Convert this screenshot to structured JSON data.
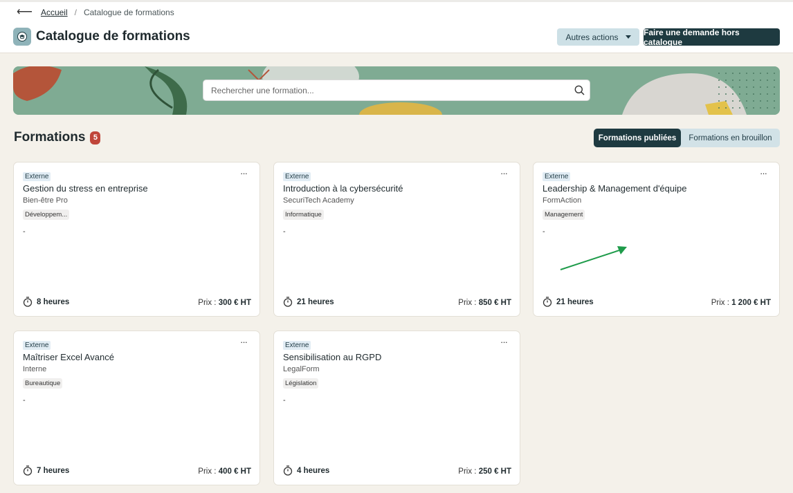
{
  "breadcrumb": {
    "home": "Accueil",
    "separator": "/",
    "current": "Catalogue de formations"
  },
  "header": {
    "title": "Catalogue de formations",
    "other_actions": "Autres actions",
    "request_button": "Faire une demande hors catalogue"
  },
  "search": {
    "placeholder": "Rechercher une formation..."
  },
  "section": {
    "title": "Formations",
    "count": "5",
    "tab_published": "Formations publiées",
    "tab_draft": "Formations en brouillon"
  },
  "price_label": "Prix : ",
  "cards": [
    {
      "badge": "Externe",
      "title": "Gestion du stress en entreprise",
      "provider": "Bien-être Pro",
      "category": "Développem...",
      "description": "-",
      "duration": "8 heures",
      "price": "300 € HT"
    },
    {
      "badge": "Externe",
      "title": "Introduction à la cybersécurité",
      "provider": "SecuriTech Academy",
      "category": "Informatique",
      "description": "-",
      "duration": "21 heures",
      "price": "850 € HT"
    },
    {
      "badge": "Externe",
      "title": "Leadership & Management d'équipe",
      "provider": "FormAction",
      "category": "Management",
      "description": "-",
      "duration": "21 heures",
      "price": "1 200 € HT"
    },
    {
      "badge": "Externe",
      "title": "Maîtriser Excel Avancé",
      "provider": "Interne",
      "category": "Bureautique",
      "description": "-",
      "duration": "7 heures",
      "price": "400 € HT"
    },
    {
      "badge": "Externe",
      "title": "Sensibilisation au RGPD",
      "provider": "LegalForm",
      "category": "Législation",
      "description": "-",
      "duration": "4 heures",
      "price": "250 € HT"
    }
  ],
  "colors": {
    "accent_dark": "#1e3a40",
    "badge_red": "#c0463a",
    "banner_green": "#7fab93",
    "arrow": "#1e9b4a"
  }
}
